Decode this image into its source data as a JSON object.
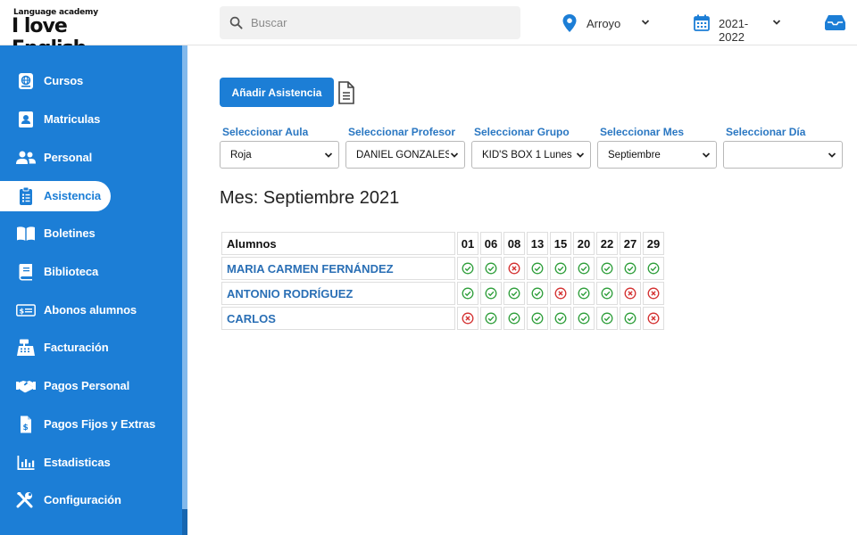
{
  "brand": {
    "small": "Language academy",
    "big": "I love English"
  },
  "search": {
    "placeholder": "Buscar"
  },
  "location": {
    "value": "Arroyo"
  },
  "year": {
    "value": "2021-2022"
  },
  "colors": {
    "accent": "#1c7ed6",
    "present": "#2e9e3a",
    "absent": "#d32f2f"
  },
  "sidebar": {
    "items": [
      {
        "label": "Cursos",
        "icon": "globe-icon"
      },
      {
        "label": "Matriculas",
        "icon": "id-card-icon"
      },
      {
        "label": "Personal",
        "icon": "users-icon"
      },
      {
        "label": "Asistencia",
        "icon": "clipboard-list-icon",
        "active": true
      },
      {
        "label": "Boletines",
        "icon": "book-open-icon"
      },
      {
        "label": "Biblioteca",
        "icon": "book-icon"
      },
      {
        "label": "Abonos alumnos",
        "icon": "money-bill-icon"
      },
      {
        "label": "Facturación",
        "icon": "cash-register-icon"
      },
      {
        "label": "Pagos Personal",
        "icon": "handshake-icon"
      },
      {
        "label": "Pagos Fijos y Extras",
        "icon": "invoice-dollar-icon"
      },
      {
        "label": "Estadisticas",
        "icon": "bar-chart-icon"
      },
      {
        "label": "Configuración",
        "icon": "tools-icon"
      }
    ]
  },
  "main": {
    "add_button": "Añadir Asistencia",
    "filters": [
      {
        "label": "Seleccionar Aula",
        "value": "Roja"
      },
      {
        "label": "Seleccionar Profesor",
        "value": "DANIEL GONZALES"
      },
      {
        "label": "Seleccionar Grupo",
        "value": "KID'S BOX 1 Lunes"
      },
      {
        "label": "Seleccionar Mes",
        "value": "Septiembre"
      },
      {
        "label": "Seleccionar Día",
        "value": ""
      }
    ],
    "month_title": "Mes: Septiembre 2021",
    "table": {
      "name_header": "Alumnos",
      "days": [
        "01",
        "06",
        "08",
        "13",
        "15",
        "20",
        "22",
        "27",
        "29"
      ],
      "rows": [
        {
          "name": "MARIA CARMEN FERNÁNDEZ",
          "marks": [
            1,
            1,
            0,
            1,
            1,
            1,
            1,
            1,
            1
          ]
        },
        {
          "name": "ANTONIO RODRÍGUEZ",
          "marks": [
            1,
            1,
            1,
            1,
            0,
            1,
            1,
            0,
            0
          ]
        },
        {
          "name": "CARLOS",
          "marks": [
            0,
            1,
            1,
            1,
            1,
            1,
            1,
            1,
            0
          ]
        }
      ]
    }
  }
}
